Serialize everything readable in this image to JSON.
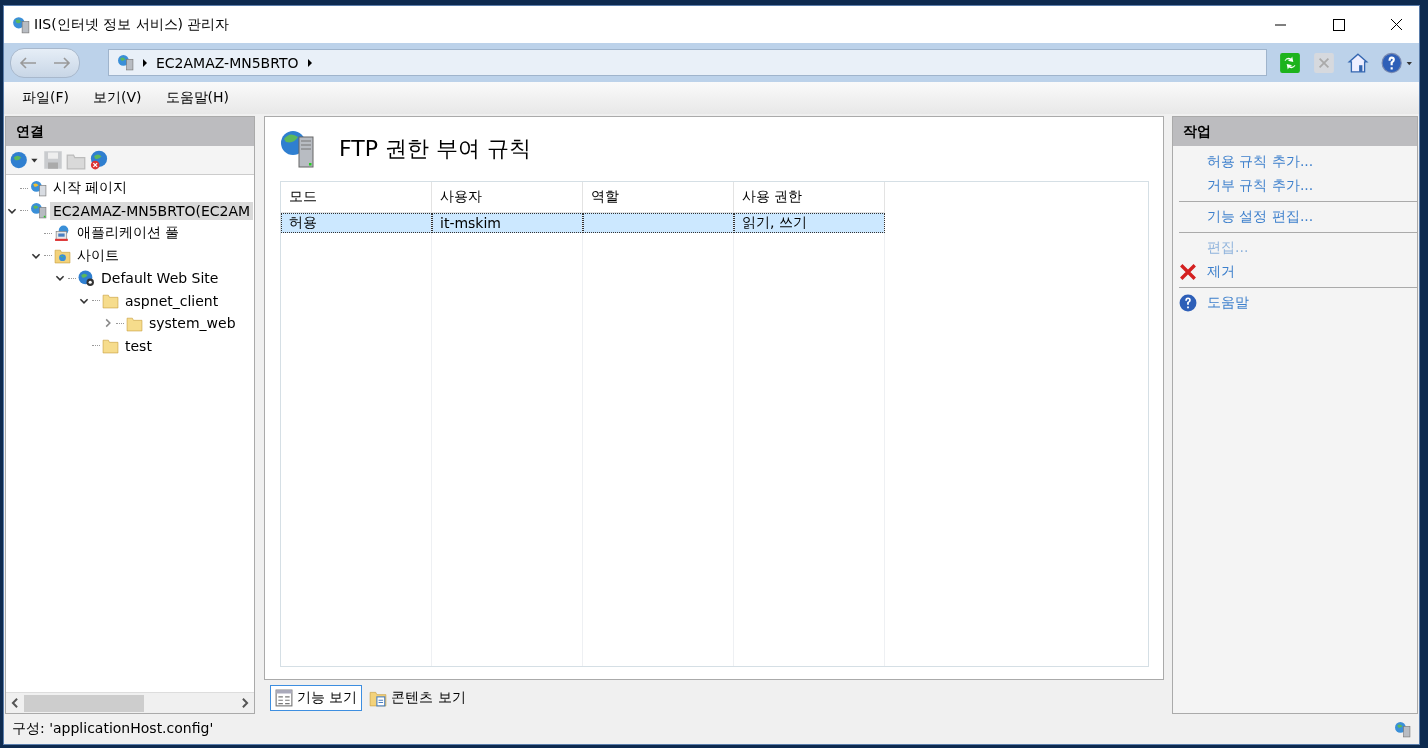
{
  "window": {
    "title": "IIS(인터넷 정보 서비스) 관리자"
  },
  "address_bar": {
    "path": [
      "EC2AMAZ-MN5BRTO"
    ]
  },
  "menu": [
    "파일(F)",
    "보기(V)",
    "도움말(H)"
  ],
  "connections": {
    "title": "연결",
    "tree": [
      {
        "label": "시작 페이지",
        "kind": "start",
        "selected": false
      },
      {
        "label": "EC2AMAZ-MN5BRTO(EC2AM",
        "kind": "server",
        "selected": true,
        "expanded": true,
        "children": [
          {
            "label": "애플리케이션 풀",
            "kind": "apppool",
            "selected": false
          },
          {
            "label": "사이트",
            "kind": "sites",
            "selected": false,
            "expanded": true,
            "children": [
              {
                "label": "Default Web Site",
                "kind": "site",
                "selected": false,
                "expanded": true,
                "children": [
                  {
                    "label": "aspnet_client",
                    "kind": "folder",
                    "selected": false,
                    "expanded": true,
                    "children": [
                      {
                        "label": "system_web",
                        "kind": "folder",
                        "selected": false,
                        "expanded": false
                      }
                    ]
                  },
                  {
                    "label": "test",
                    "kind": "folder",
                    "selected": false
                  }
                ]
              }
            ]
          }
        ]
      }
    ]
  },
  "feature": {
    "title": "FTP 권한 부여 규칙",
    "table": {
      "columns": [
        "모드",
        "사용자",
        "역할",
        "사용 권한"
      ],
      "rows": [
        {
          "cells": [
            "허용",
            "it-mskim",
            "",
            "읽기, 쓰기"
          ],
          "selected": true
        }
      ]
    },
    "views": [
      {
        "label": "기능 보기",
        "kind": "features",
        "selected": true
      },
      {
        "label": "콘텐츠 보기",
        "kind": "content",
        "selected": false
      }
    ]
  },
  "actions": {
    "title": "작업",
    "groups": [
      [
        {
          "label": "허용 규칙 추가...",
          "disabled": false
        },
        {
          "label": "거부 규칙 추가...",
          "disabled": false
        }
      ],
      [
        {
          "label": "기능 설정 편집...",
          "disabled": false
        }
      ],
      [
        {
          "label": "편집...",
          "disabled": true
        },
        {
          "label": "제거",
          "disabled": false,
          "kind": "remove"
        }
      ],
      [
        {
          "label": "도움말",
          "disabled": false,
          "kind": "help"
        }
      ]
    ]
  },
  "status_bar": {
    "text": "구성: 'applicationHost.config'"
  }
}
